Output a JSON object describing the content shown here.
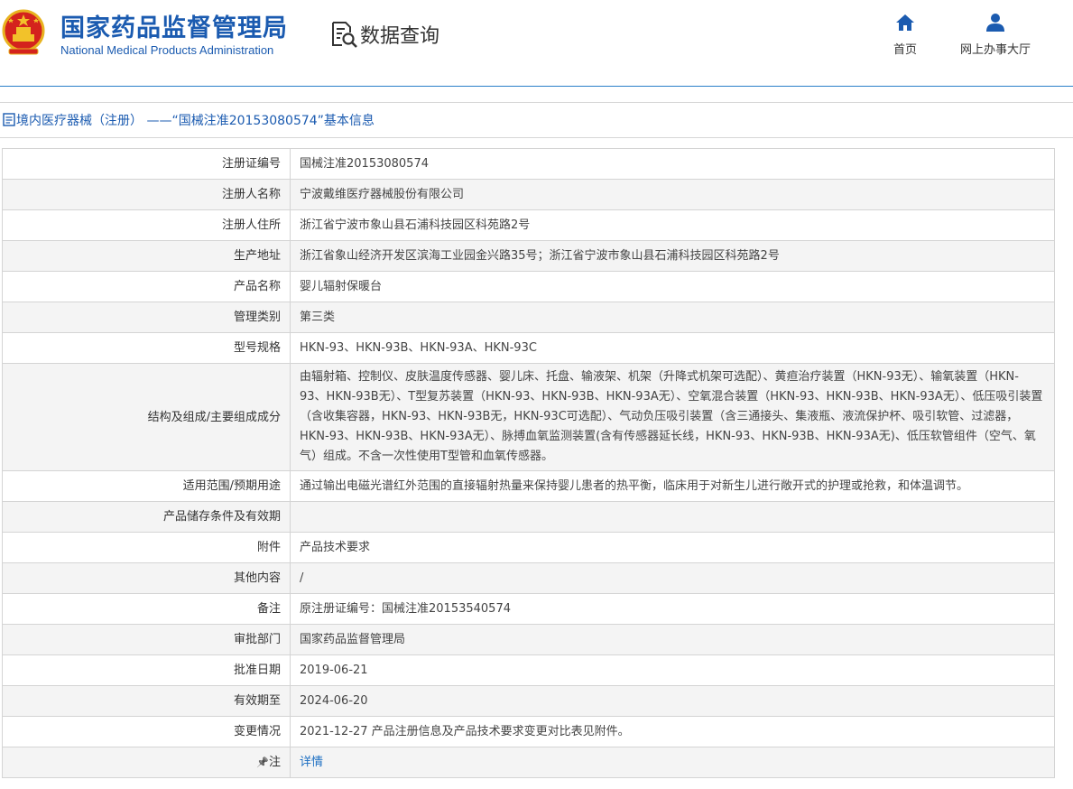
{
  "header": {
    "org_name_cn": "国家药品监督管理局",
    "org_name_en": "National Medical Products Administration",
    "query_label": "数据查询",
    "nav": [
      {
        "icon": "home-icon",
        "label": "首页"
      },
      {
        "icon": "user-icon",
        "label": "网上办事大厅"
      }
    ],
    "brand_color": "#1b5bb0",
    "line_color": "#2a7fc9"
  },
  "title_bar": {
    "icon": "document-icon",
    "text": "境内医疗器械（注册） ——“国械注准20153080574”基本信息"
  },
  "rows": [
    {
      "label": "注册证编号",
      "value": "国械注准20153080574"
    },
    {
      "label": "注册人名称",
      "value": "宁波戴维医疗器械股份有限公司"
    },
    {
      "label": "注册人住所",
      "value": "浙江省宁波市象山县石浦科技园区科苑路2号"
    },
    {
      "label": "生产地址",
      "value": "浙江省象山经济开发区滨海工业园金兴路35号；浙江省宁波市象山县石浦科技园区科苑路2号"
    },
    {
      "label": "产品名称",
      "value": "婴儿辐射保暖台"
    },
    {
      "label": "管理类别",
      "value": "第三类"
    },
    {
      "label": "型号规格",
      "value": "HKN-93、HKN-93B、HKN-93A、HKN-93C"
    },
    {
      "label": "结构及组成/主要组成成分",
      "value": "由辐射箱、控制仪、皮肤温度传感器、婴儿床、托盘、输液架、机架（升降式机架可选配）、黄疸治疗装置（HKN-93无）、输氧装置（HKN-93、HKN-93B无）、T型复苏装置（HKN-93、HKN-93B、HKN-93A无）、空氧混合装置（HKN-93、HKN-93B、HKN-93A无）、低压吸引装置（含收集容器，HKN-93、HKN-93B无，HKN-93C可选配）、气动负压吸引装置（含三通接头、集液瓶、液流保护杯、吸引软管、过滤器，HKN-93、HKN-93B、HKN-93A无）、脉搏血氧监测装置(含有传感器延长线，HKN-93、HKN-93B、HKN-93A无)、低压软管组件（空气、氧气）组成。不含一次性使用T型管和血氧传感器。"
    },
    {
      "label": "适用范围/预期用途",
      "value": "通过输出电磁光谱红外范围的直接辐射热量来保持婴儿患者的热平衡，临床用于对新生儿进行敞开式的护理或抢救，和体温调节。"
    },
    {
      "label": "产品储存条件及有效期",
      "value": ""
    },
    {
      "label": "附件",
      "value": "产品技术要求"
    },
    {
      "label": "其他内容",
      "value": "/"
    },
    {
      "label": "备注",
      "value": "原注册证编号：国械注准20153540574"
    },
    {
      "label": "审批部门",
      "value": "国家药品监督管理局"
    },
    {
      "label": "批准日期",
      "value": "2019-06-21"
    },
    {
      "label": "有效期至",
      "value": "2024-06-20"
    },
    {
      "label": "变更情况",
      "value": "2021-12-27 产品注册信息及产品技术要求变更对比表见附件。"
    }
  ],
  "note_row": {
    "icon": "pin-icon",
    "label": "注",
    "link_text": "详情"
  }
}
